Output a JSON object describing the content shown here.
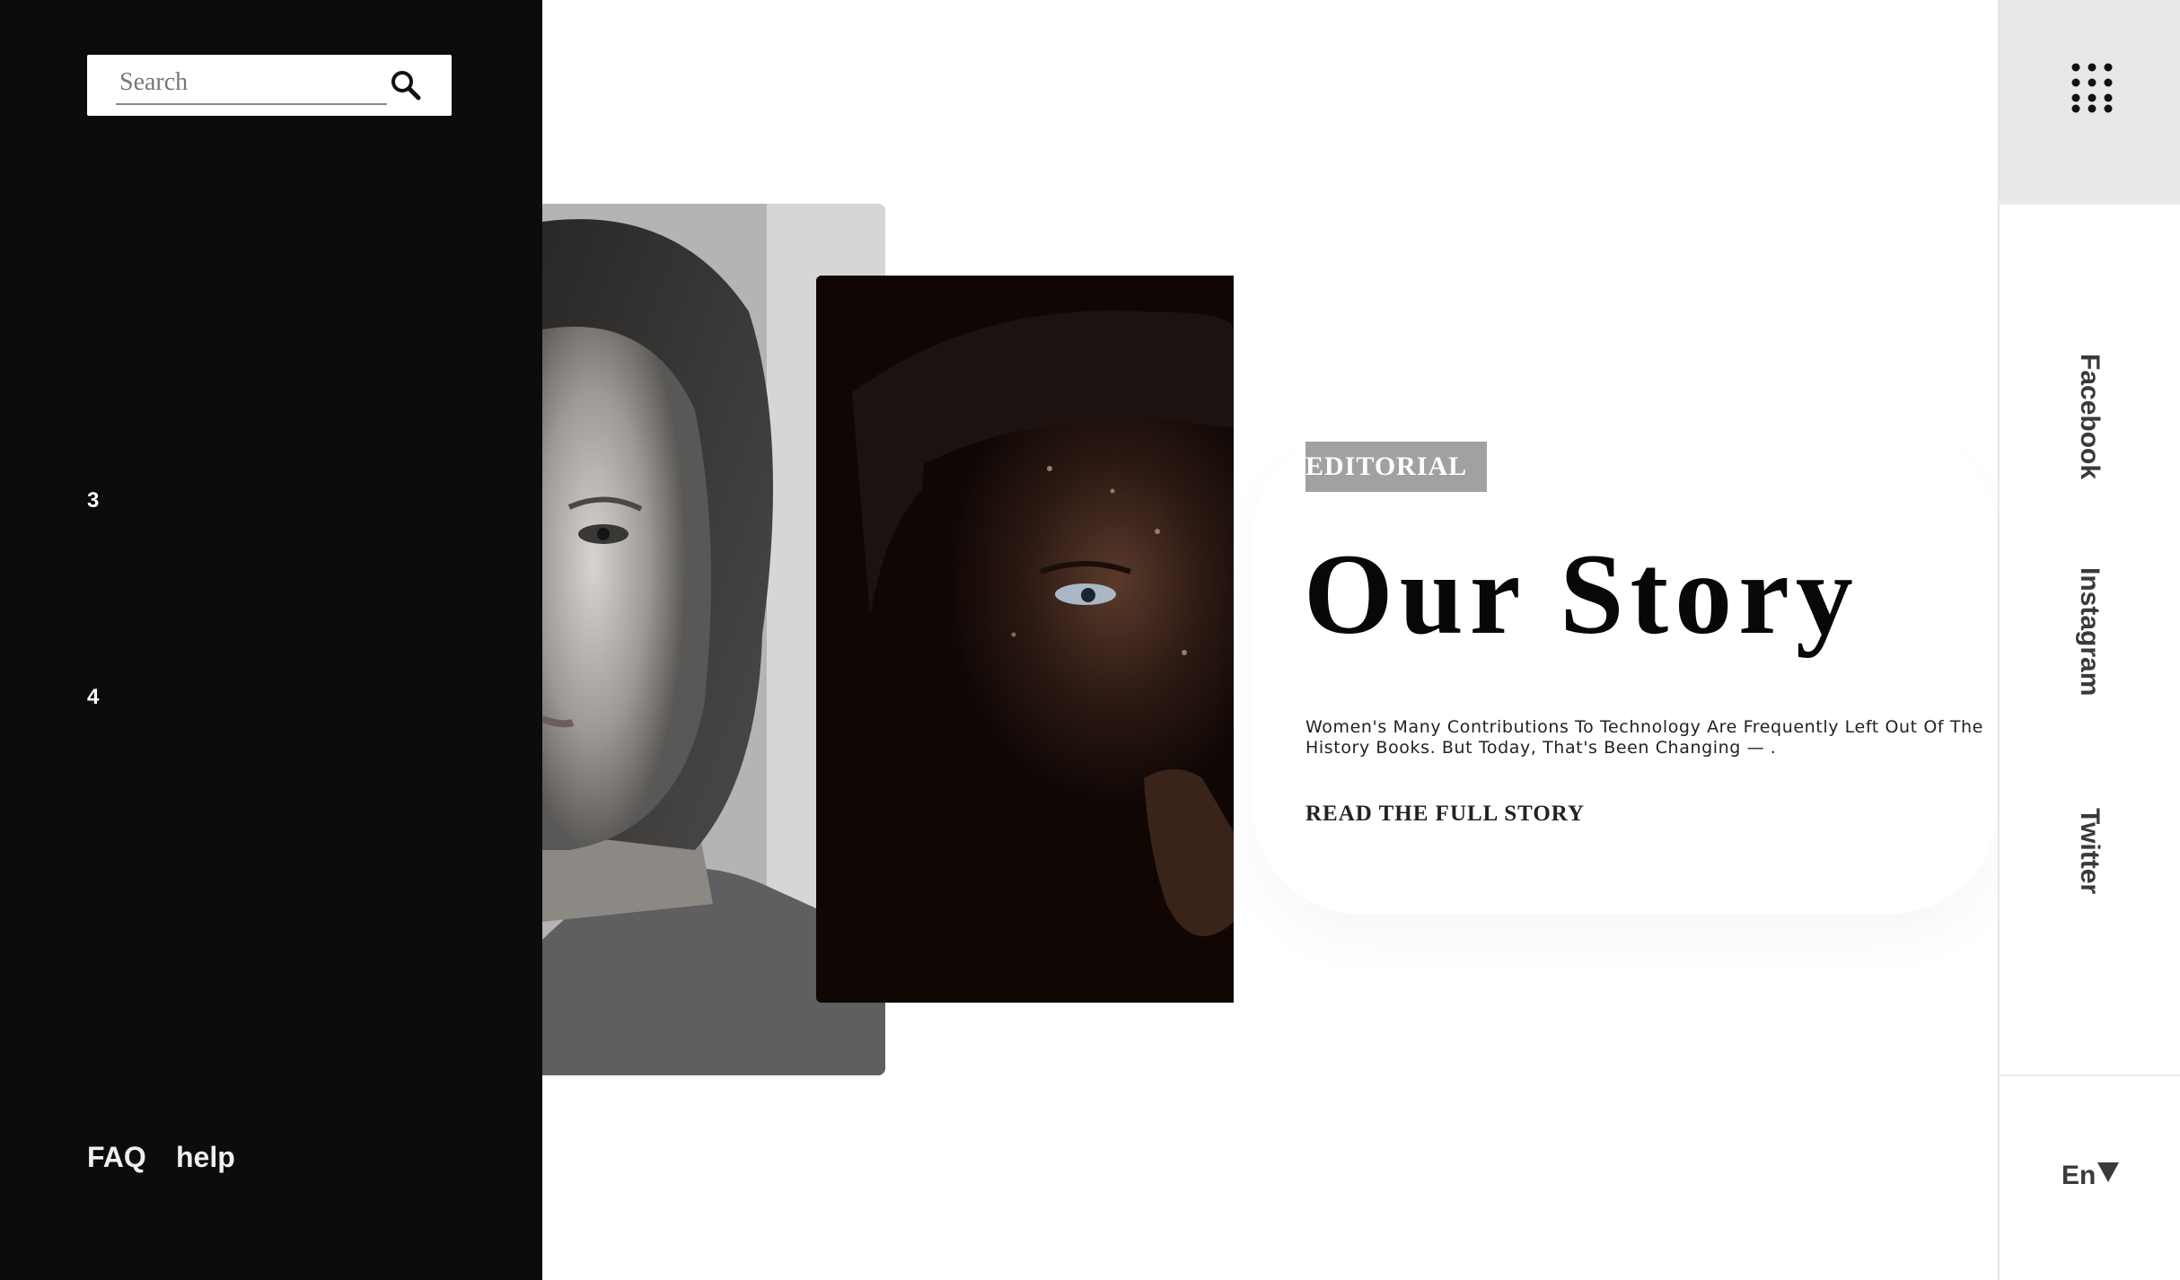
{
  "search": {
    "placeholder": "Search"
  },
  "sidebar": {
    "slide_numbers": [
      "3",
      "4"
    ],
    "footer_links": [
      "FAQ",
      "help"
    ]
  },
  "article": {
    "tag": "EDITORIAL",
    "title": "Our Story",
    "description": "Women's Many Contributions To Technology Are Frequently Left Out Of The History Books. But Today, That's Been Changing — .",
    "cta": "READ THE FULL STORY"
  },
  "social": {
    "links": [
      "Facebook",
      "Instagram",
      "Twitter"
    ]
  },
  "language": {
    "selected": "En"
  },
  "icons": {
    "search": "search-icon",
    "menu": "grid-menu-icon",
    "dropdown": "caret-down-icon"
  },
  "colors": {
    "sidebar_bg": "#0c0c0c",
    "tag_bg": "#a1a1a1",
    "menu_bg": "#e9e8e6",
    "text_dark": "#080808"
  }
}
